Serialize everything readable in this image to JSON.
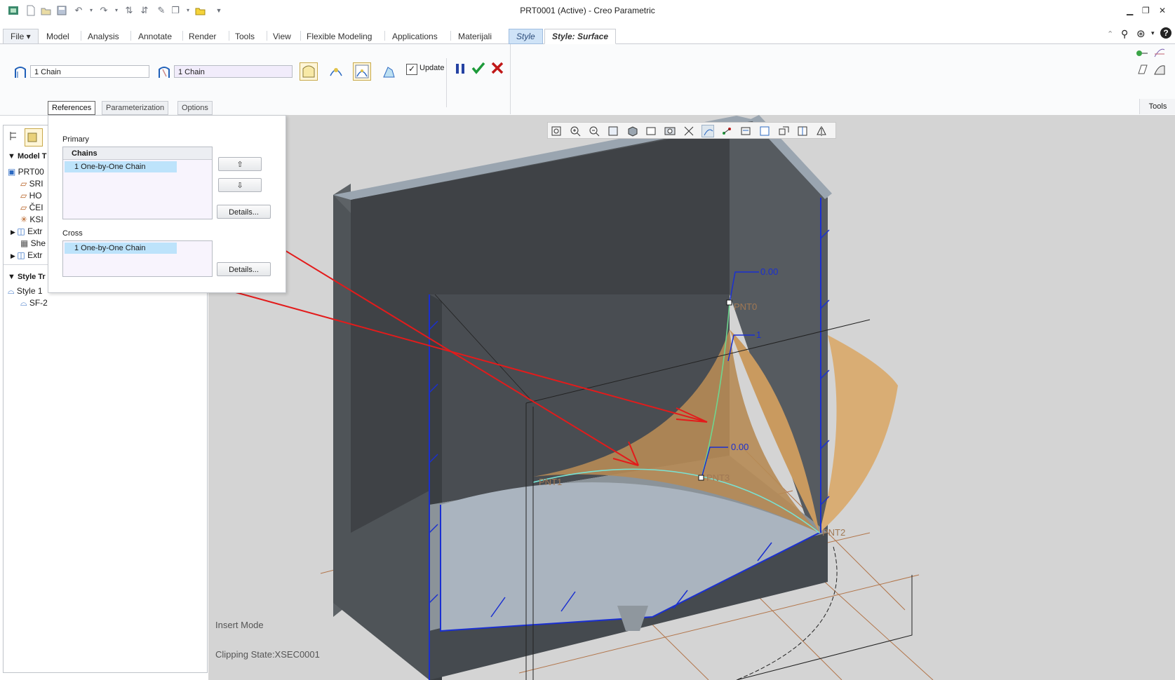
{
  "window": {
    "title": "PRT0001 (Active) - Creo Parametric"
  },
  "tabs": [
    {
      "label": "File ▾"
    },
    {
      "label": "Model"
    },
    {
      "label": "Analysis"
    },
    {
      "label": "Annotate"
    },
    {
      "label": "Render"
    },
    {
      "label": "Tools"
    },
    {
      "label": "View"
    },
    {
      "label": "Flexible Modeling"
    },
    {
      "label": "Applications"
    },
    {
      "label": "Materijali"
    },
    {
      "label": "Style"
    },
    {
      "label": "Style: Surface"
    }
  ],
  "dashboard": {
    "primary_field": "1 Chain",
    "cross_field": "1 Chain",
    "update_label": "Update",
    "update_checked": true,
    "subtabs": [
      "References",
      "Parameterization",
      "Options"
    ],
    "tools_label": "Tools"
  },
  "references": {
    "primary_label": "Primary",
    "chains_header": "Chains",
    "primary_item": "1 One-by-One Chain",
    "cross_label": "Cross",
    "cross_item": "1 One-by-One Chain",
    "details_label": "Details..."
  },
  "tree": {
    "model_header": "Model T",
    "items": [
      "PRT00",
      "SRI",
      "HO",
      "ČEI",
      "KSI",
      "Extr",
      "She",
      "Extr"
    ],
    "style_header": "Style Tr",
    "style_items": [
      "Style 1",
      "SF-2"
    ]
  },
  "graphics": {
    "points": [
      "PNT0",
      "PNT1",
      "PNT2",
      "PNT3"
    ],
    "dims": [
      "0.00",
      "1",
      "0.00"
    ]
  },
  "status": {
    "mode": "Insert Mode",
    "clipping": "Clipping State:XSEC0001"
  },
  "colors": {
    "accent": "#2c4c7a",
    "surface": "#d6a265",
    "curve_primary": "#6fd68f",
    "arrow": "#e31b1b"
  }
}
